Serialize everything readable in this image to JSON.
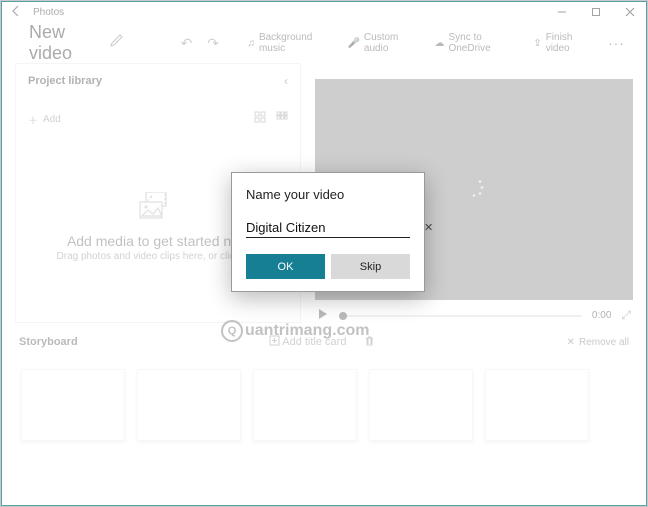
{
  "window": {
    "app_title": "Photos"
  },
  "header": {
    "video_title": "New video",
    "tools": {
      "bg_music": "Background music",
      "custom_audio": "Custom audio",
      "sync": "Sync to OneDrive",
      "finish": "Finish video"
    }
  },
  "library": {
    "title": "Project library",
    "add_label": "Add",
    "empty_title": "Add media to get started now",
    "empty_sub": "Drag photos and video clips here, or click Add"
  },
  "preview": {
    "time": "0:00"
  },
  "storyboard": {
    "title": "Storyboard",
    "add_title_card": "Add title card",
    "remove_all": "Remove all"
  },
  "dialog": {
    "title": "Name your video",
    "value": "Digital Citizen",
    "ok": "OK",
    "skip": "Skip"
  },
  "watermark": "uantrimang.com"
}
